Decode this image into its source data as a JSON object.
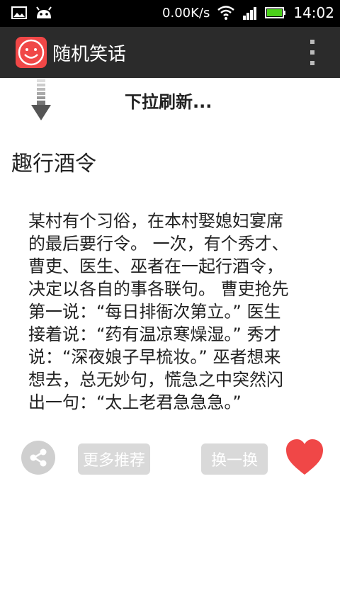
{
  "status_bar": {
    "network_speed": "0.00K/s",
    "time": "14:02"
  },
  "app_bar": {
    "title": "随机笑话"
  },
  "refresh": {
    "text": "下拉刷新..."
  },
  "joke": {
    "title": "趣行酒令",
    "body": "某村有个习俗，在本村娶媳妇宴席\n的最后要行令。 一次，有个秀才、\n曹吏、医生、巫者在一起行酒令，\n决定以各自的事各联句。 曹吏抢先\n第一说：“每日排衙次第立。” 医生\n接着说：“药有温凉寒燥湿。” 秀才\n说：“深夜娘子早梳妆。” 巫者想来\n想去，总无妙句，慌急之中突然闪\n出一句：“太上老君急急急。”"
  },
  "actions": {
    "more_label": "更多推荐",
    "swap_label": "换一换"
  },
  "colors": {
    "status_bg": "#000000",
    "appbar_bg": "#2b2b2b",
    "logo_bg": "#f04747",
    "heart": "#f04747",
    "button_bg": "#d9d9d9"
  }
}
